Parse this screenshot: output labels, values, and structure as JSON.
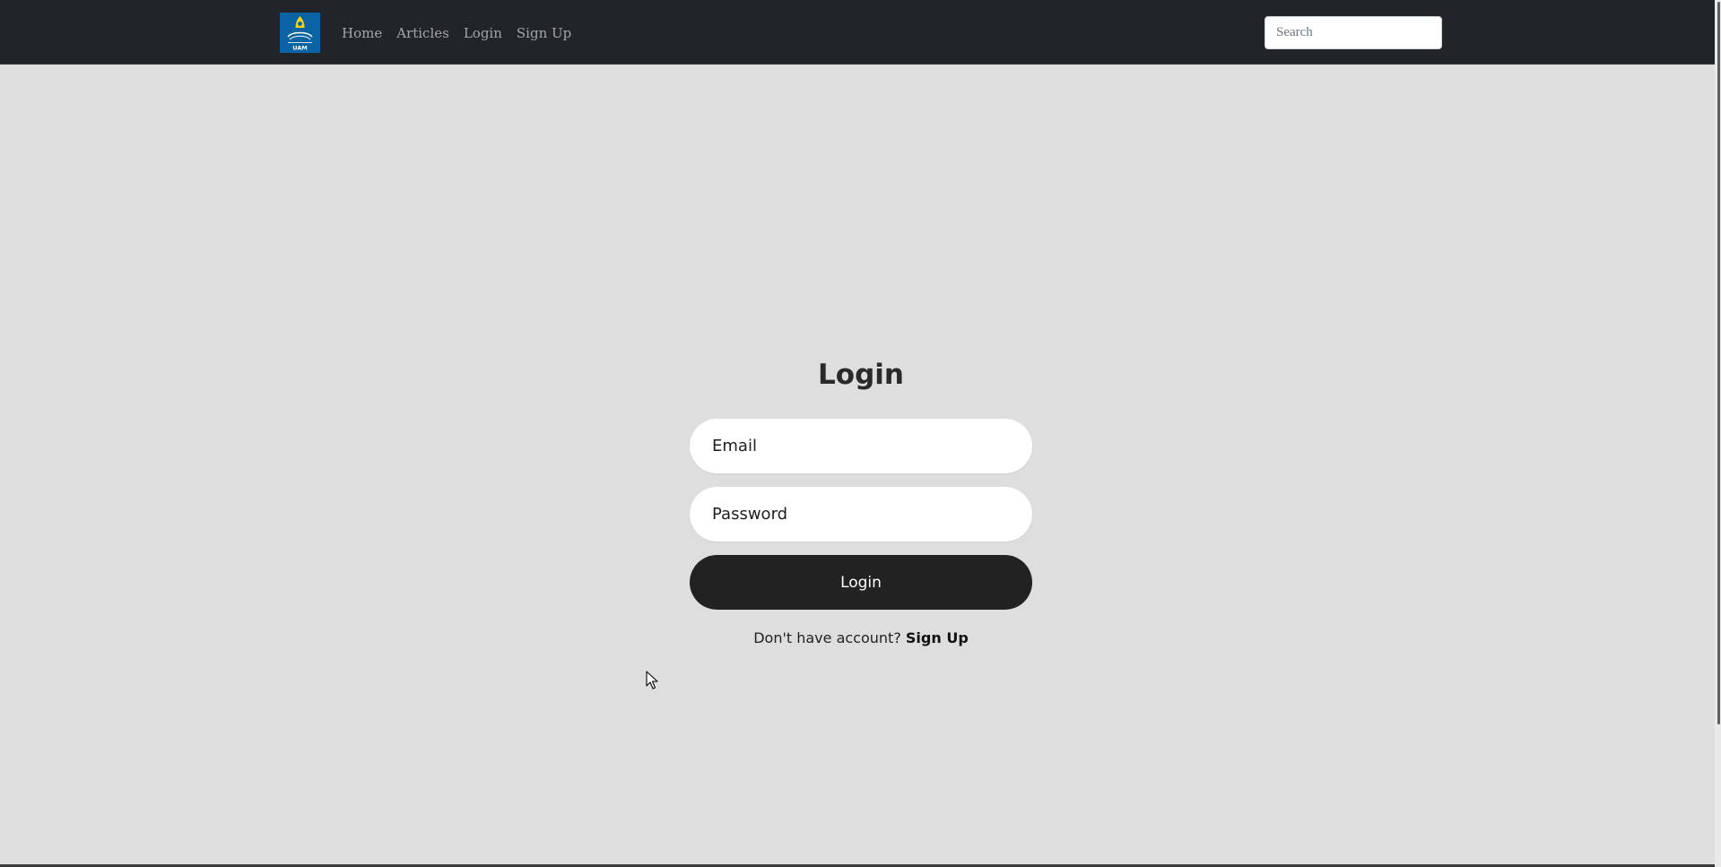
{
  "navbar": {
    "brand_alt": "UAM",
    "brand_text": "UAM",
    "links": [
      {
        "label": "Home"
      },
      {
        "label": "Articles"
      },
      {
        "label": "Login"
      },
      {
        "label": "Sign Up"
      }
    ],
    "search": {
      "placeholder": "Search",
      "value": ""
    }
  },
  "login": {
    "title": "Login",
    "email_placeholder": "Email",
    "password_placeholder": "Password",
    "submit_label": "Login",
    "signup_prompt": "Don't have account?",
    "signup_link": "Sign Up"
  },
  "colors": {
    "navbar_bg": "#212429",
    "page_bg": "#dedede",
    "brand_bg": "#0b63a3",
    "button_bg": "#222222"
  },
  "icons": {
    "brand": "university-logo-icon",
    "cursor": "mouse-pointer-icon"
  }
}
